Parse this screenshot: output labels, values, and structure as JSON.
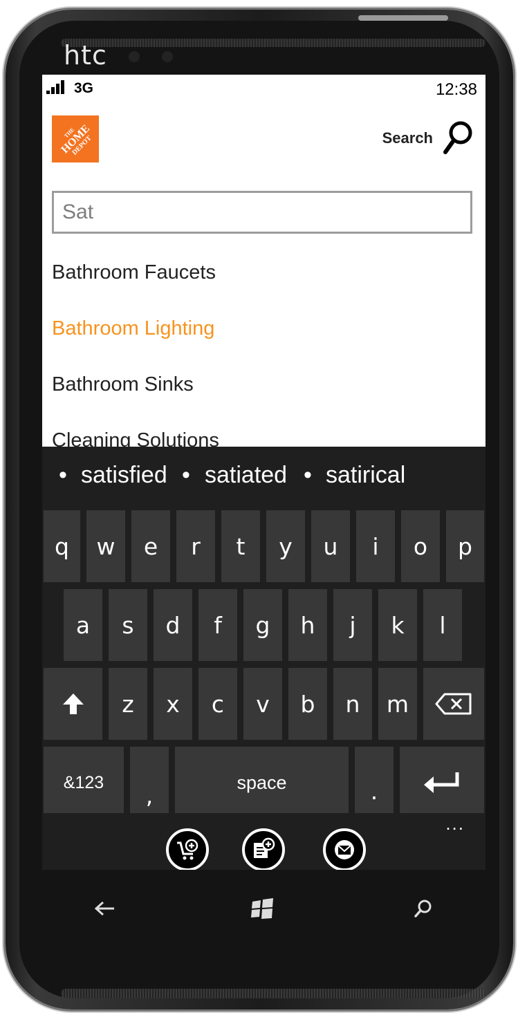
{
  "device": {
    "brand": "htc"
  },
  "status_bar": {
    "network": "3G",
    "time": "12:38",
    "signal_bars": 4
  },
  "header": {
    "logo_text": "THE HOME DEPOT",
    "search_label": "Search"
  },
  "search": {
    "value": "Sat",
    "placeholder": ""
  },
  "suggestions": [
    {
      "label": "Bathroom Faucets",
      "active": false
    },
    {
      "label": "Bathroom Lighting",
      "active": true
    },
    {
      "label": "Bathroom Sinks",
      "active": false
    },
    {
      "label": "Cleaning Solutions",
      "active": false
    }
  ],
  "keyboard": {
    "predictions": [
      "satisfied",
      "satiated",
      "satirical"
    ],
    "row1": [
      "q",
      "w",
      "e",
      "r",
      "t",
      "y",
      "u",
      "i",
      "o",
      "p"
    ],
    "row2": [
      "a",
      "s",
      "d",
      "f",
      "g",
      "h",
      "j",
      "k",
      "l"
    ],
    "row3": [
      "z",
      "x",
      "c",
      "v",
      "b",
      "n",
      "m"
    ],
    "symbols_label": "&123",
    "comma_label": ",",
    "space_label": "space",
    "period_label": "."
  },
  "appbar": {
    "icons": [
      "add-to-cart-icon",
      "add-note-icon",
      "mail-icon"
    ],
    "more_label": "..."
  },
  "hardware_buttons": [
    "back-icon",
    "windows-start-icon",
    "search-icon"
  ],
  "colors": {
    "accent": "#f7931e",
    "logo_orange": "#f37321",
    "keyboard_bg": "#1f1f1f",
    "key_bg": "#383838"
  }
}
